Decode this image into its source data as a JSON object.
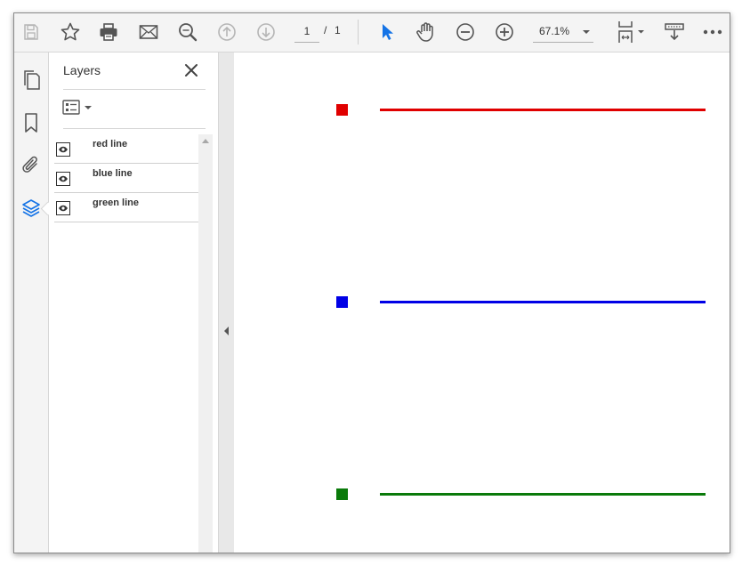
{
  "toolbar": {
    "page_current": "1",
    "page_separator": "/",
    "page_total": "1",
    "zoom": "67.1%"
  },
  "panel": {
    "title": "Layers"
  },
  "layers": [
    {
      "name": "red line",
      "visible": true
    },
    {
      "name": "blue line",
      "visible": true
    },
    {
      "name": "green line",
      "visible": true
    }
  ],
  "colors": {
    "red": "#e00000",
    "blue": "#0000e6",
    "green": "#0a7a0a",
    "accent": "#1473e6"
  }
}
